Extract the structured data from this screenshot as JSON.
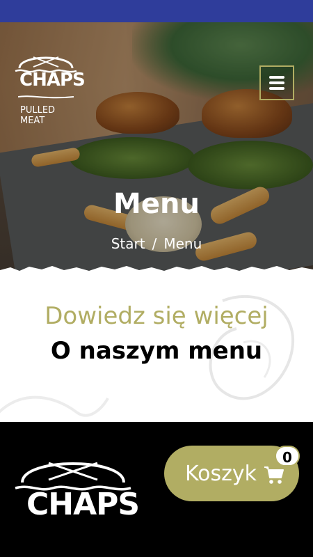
{
  "colors": {
    "accent": "#b1ad63",
    "status_bar": "#2f3d9b",
    "footer_bg": "#000000"
  },
  "header": {
    "logo": {
      "wordmark": "CHAPS",
      "tagline": "PULLED MEAT"
    },
    "menu_toggle_icon": "hamburger-icon"
  },
  "hero": {
    "title": "Menu",
    "breadcrumb": {
      "home": "Start",
      "separator": "/",
      "current": "Menu"
    }
  },
  "info": {
    "kicker": "Dowiedz się więcej",
    "heading": "O naszym menu"
  },
  "footer": {
    "logo": {
      "wordmark": "CHAPS"
    },
    "cart": {
      "label": "Koszyk",
      "count": "0",
      "icon": "cart-icon"
    }
  }
}
